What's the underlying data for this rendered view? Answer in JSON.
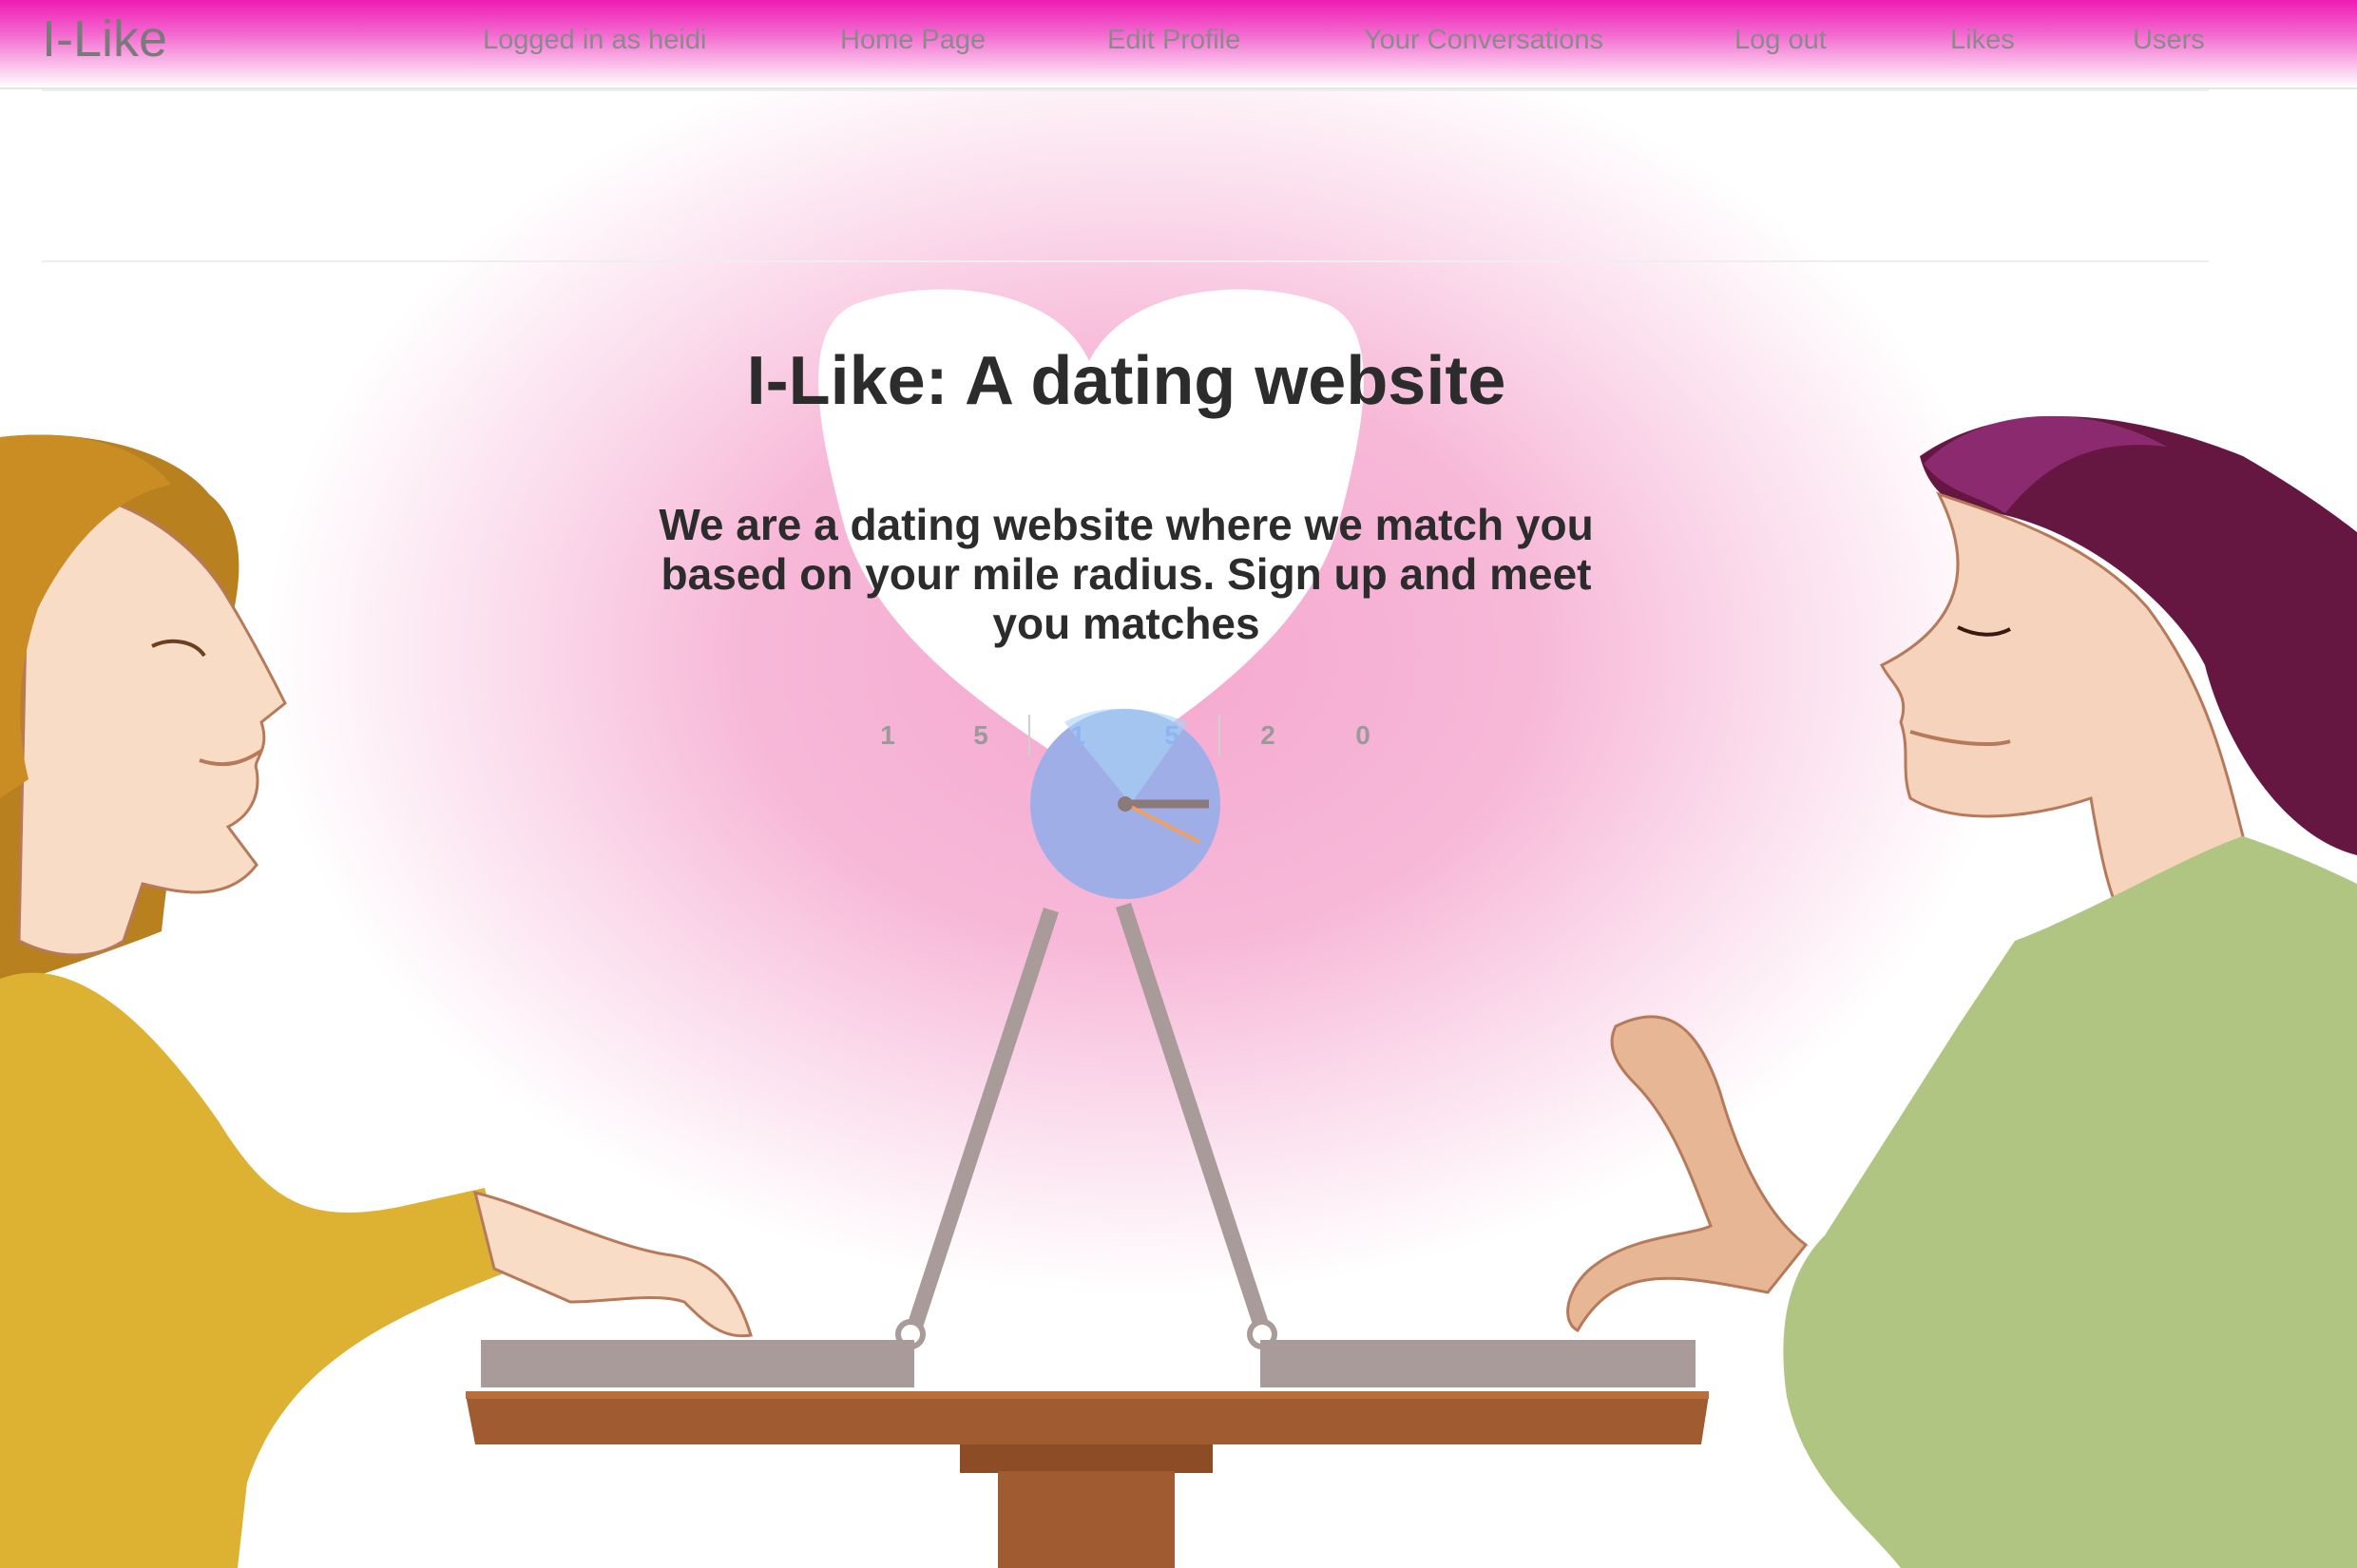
{
  "navbar": {
    "brand": "I-Like",
    "links": [
      {
        "label": "Logged in as heidi"
      },
      {
        "label": "Home Page"
      },
      {
        "label": "Edit Profile"
      },
      {
        "label": "Your Conversations"
      },
      {
        "label": "Log out"
      },
      {
        "label": "Likes"
      },
      {
        "label": "Users"
      }
    ],
    "gradient_top": "#ee1cb4"
  },
  "hero": {
    "title": "I-Like: A dating website",
    "subtitle": "We are a dating website where we match you based on your mile radius. Sign up and meet you matches",
    "counter_digits": [
      "1",
      "5",
      "1",
      "5",
      "2",
      "0"
    ]
  },
  "colors": {
    "glow": "#f5a9cf",
    "heart": "#ffffff",
    "clock": "#a0aee8",
    "laptop": "#a89b99",
    "table": "#a15b30",
    "woman_shirt": "#ddb232",
    "man_shirt": "#b1c582",
    "man_hair": "#651741",
    "woman_hair": "#b8801e"
  },
  "icons": [
    "clock-icon",
    "heart-icon"
  ]
}
